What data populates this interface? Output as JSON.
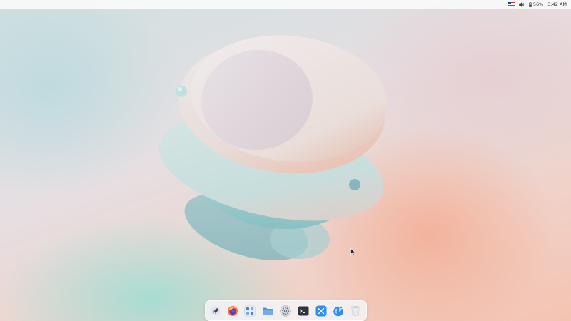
{
  "top_bar": {
    "tray": {
      "input_language_flag": "us-flag-icon",
      "volume_icon": "speaker-icon",
      "battery_percent": "56%",
      "clock": "3:42 AM"
    }
  },
  "wallpaper": {
    "colors": {
      "teal": "#9fd7d2",
      "peach": "#f3b49f",
      "lilac": "#ddd3df"
    }
  },
  "dock": {
    "items": [
      {
        "icon": "rocket-icon",
        "name": "launcher"
      },
      {
        "icon": "firefox-icon",
        "name": "firefox"
      },
      {
        "icon": "app-grid-icon",
        "name": "app-grid"
      },
      {
        "icon": "folder-icon",
        "name": "files"
      },
      {
        "icon": "settings-icon",
        "name": "settings"
      },
      {
        "icon": "terminal-icon",
        "name": "terminal"
      },
      {
        "icon": "app-store-icon",
        "name": "app-store"
      },
      {
        "icon": "globe-icon",
        "name": "browser"
      },
      {
        "icon": "trash-icon",
        "name": "trash"
      }
    ]
  }
}
